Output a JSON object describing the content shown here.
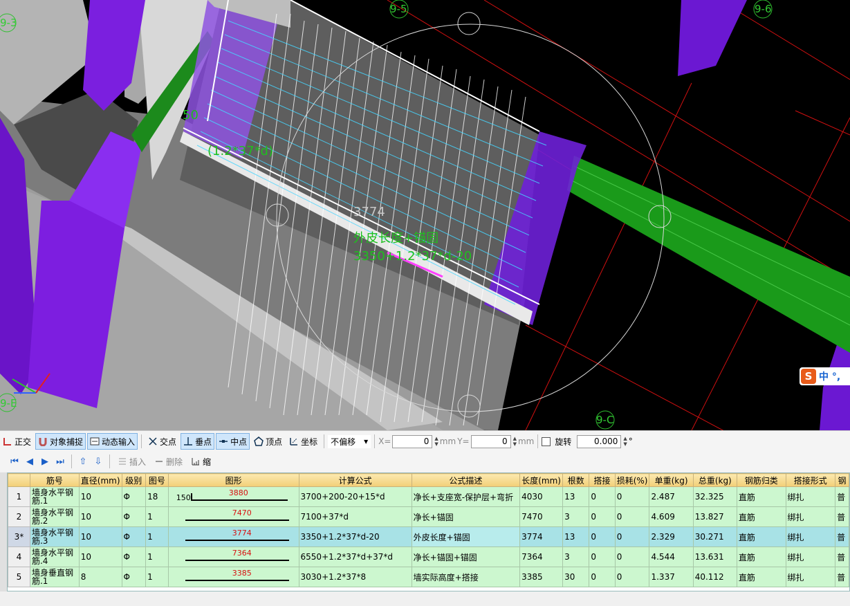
{
  "viewport": {
    "axis_labels": [
      "9-3",
      "9-5",
      "9-6",
      "9-E",
      "9-C"
    ],
    "annotations": [
      "50",
      "(1.2*37*d)",
      "3774",
      "外皮长度+锚固",
      "3350+1.2*37*d-20"
    ]
  },
  "snap_toolbar": {
    "ortho": "正交",
    "object_snap": "对象捕捉",
    "dynamic_input": "动态输入",
    "intersection": "交点",
    "perpendicular": "垂点",
    "midpoint": "中点",
    "vertex": "顶点",
    "coordinate": "坐标",
    "offset_mode": "不偏移",
    "x_label": "X=",
    "x_value": "0",
    "x_unit": "mm",
    "y_label": "Y=",
    "y_value": "0",
    "y_unit": "mm",
    "rotate_label": "旋转",
    "rotate_value": "0.000",
    "rotate_unit": "°"
  },
  "grid_toolbar": {
    "insert": "插入",
    "delete": "删除",
    "scale": "缩"
  },
  "ime": {
    "text": "中 °,"
  },
  "table": {
    "headers": [
      "筋号",
      "直径(mm)",
      "级别",
      "图号",
      "图形",
      "计算公式",
      "公式描述",
      "长度(mm)",
      "根数",
      "搭接",
      "损耗(%)",
      "单重(kg)",
      "总重(kg)",
      "钢筋归类",
      "搭接形式",
      "钢"
    ],
    "rows": [
      {
        "no": "1",
        "name": "墙身水平钢筋.1",
        "dia": "10",
        "grade": "Φ",
        "fig": "18",
        "shape_prefix": "150",
        "shape_len": "3880",
        "formula": "3700+200-20+15*d",
        "desc": "净长+支座宽-保护层+弯折",
        "length": "4030",
        "count": "13",
        "lap": "0",
        "loss": "0",
        "unit_w": "2.487",
        "total_w": "32.325",
        "category": "直筋",
        "lap_type": "绑扎",
        "extra": "普"
      },
      {
        "no": "2",
        "name": "墙身水平钢筋.2",
        "dia": "10",
        "grade": "Φ",
        "fig": "1",
        "shape_prefix": "",
        "shape_len": "7470",
        "formula": "7100+37*d",
        "desc": "净长+锚固",
        "length": "7470",
        "count": "3",
        "lap": "0",
        "loss": "0",
        "unit_w": "4.609",
        "total_w": "13.827",
        "category": "直筋",
        "lap_type": "绑扎",
        "extra": "普"
      },
      {
        "no": "3*",
        "name": "墙身水平钢筋.3",
        "dia": "10",
        "grade": "Φ",
        "fig": "1",
        "shape_prefix": "",
        "shape_len": "3774",
        "formula": "3350+1.2*37*d-20",
        "desc": "外皮长度+锚固",
        "length": "3774",
        "count": "13",
        "lap": "0",
        "loss": "0",
        "unit_w": "2.329",
        "total_w": "30.271",
        "category": "直筋",
        "lap_type": "绑扎",
        "extra": "普"
      },
      {
        "no": "4",
        "name": "墙身水平钢筋.4",
        "dia": "10",
        "grade": "Φ",
        "fig": "1",
        "shape_prefix": "",
        "shape_len": "7364",
        "formula": "6550+1.2*37*d+37*d",
        "desc": "净长+锚固+锚固",
        "length": "7364",
        "count": "3",
        "lap": "0",
        "loss": "0",
        "unit_w": "4.544",
        "total_w": "13.631",
        "category": "直筋",
        "lap_type": "绑扎",
        "extra": "普"
      },
      {
        "no": "5",
        "name": "墙身垂直钢筋.1",
        "dia": "8",
        "grade": "Φ",
        "fig": "1",
        "shape_prefix": "",
        "shape_len": "3385",
        "formula": "3030+1.2*37*8",
        "desc": "墙实际高度+搭接",
        "length": "3385",
        "count": "30",
        "lap": "0",
        "loss": "0",
        "unit_w": "1.337",
        "total_w": "40.112",
        "category": "直筋",
        "lap_type": "绑扎",
        "extra": "普"
      }
    ]
  }
}
